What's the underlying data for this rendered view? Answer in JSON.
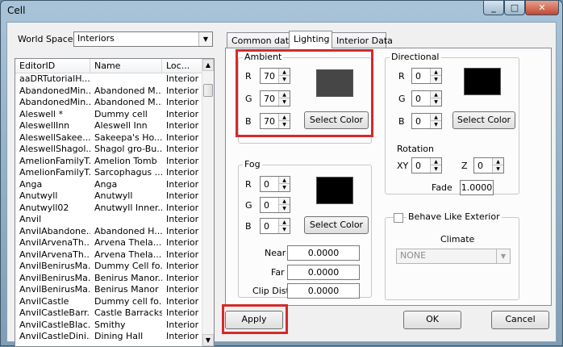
{
  "window": {
    "title": "Cell",
    "minimize": "_",
    "maximize": "□",
    "close": "✕"
  },
  "worldspace": {
    "label": "World Space",
    "value": "Interiors"
  },
  "cell_list": {
    "columns": [
      "EditorID",
      "Name",
      "Loc..."
    ],
    "rows": [
      [
        "aaDRTutorialH...",
        "",
        "Interior"
      ],
      [
        "AbandonedMin...",
        "Abandoned M...",
        "Interior"
      ],
      [
        "AbandonedMin...",
        "Abandoned M...",
        "Interior"
      ],
      [
        "Aleswell *",
        "Dummy cell",
        "Interior"
      ],
      [
        "AleswellInn",
        "Aleswell Inn",
        "Interior"
      ],
      [
        "AleswellSakee...",
        "Sakeepa's Ho...",
        "Interior"
      ],
      [
        "AleswellShagol...",
        "Shagol gro-Bu...",
        "Interior"
      ],
      [
        "AmelionFamilyT...",
        "Amelion Tomb",
        "Interior"
      ],
      [
        "AmelionFamilyT...",
        "Sarcophagus ...",
        "Interior"
      ],
      [
        "Anga",
        "Anga",
        "Interior"
      ],
      [
        "Anutwyll",
        "Anutwyll",
        "Interior"
      ],
      [
        "Anutwyll02",
        "Anutwyll Inner...",
        "Interior"
      ],
      [
        "Anvil",
        "",
        "Interior"
      ],
      [
        "AnvilAbandone...",
        "Abandoned H...",
        "Interior"
      ],
      [
        "AnvilArvenaTh...",
        "Arvena Thela...",
        "Interior"
      ],
      [
        "AnvilArvenaTh...",
        "Arvena Thela...",
        "Interior"
      ],
      [
        "AnvilBenirusMa...",
        "Dummy Cell fo...",
        "Interior"
      ],
      [
        "AnvilBenirusMa...",
        "Benirus Manor...",
        "Interior"
      ],
      [
        "AnvilBenirusMa...",
        "Benirus Manor",
        "Interior"
      ],
      [
        "AnvilCastle",
        "Dummy cell fo...",
        "Interior"
      ],
      [
        "AnvilCastleBarr...",
        "Castle Barracks",
        "Interior"
      ],
      [
        "AnvilCastleBlac...",
        "Smithy",
        "Interior"
      ],
      [
        "AnvilCastleDini...",
        "Dining Hall",
        "Interior"
      ]
    ]
  },
  "tabs": [
    "Common data",
    "Lighting",
    "Interior Data"
  ],
  "ambient": {
    "title": "Ambient",
    "r_label": "R",
    "g_label": "G",
    "b_label": "B",
    "r": "70",
    "g": "70",
    "b": "70",
    "swatch_color": "#464646",
    "button": "Select Color"
  },
  "directional": {
    "title": "Directional",
    "r_label": "R",
    "g_label": "G",
    "b_label": "B",
    "r": "0",
    "g": "0",
    "b": "0",
    "swatch_color": "#000000",
    "button": "Select Color",
    "rotation_label": "Rotation",
    "xy_label": "XY",
    "z_label": "Z",
    "xy": "0",
    "z": "0",
    "fade_label": "Fade",
    "fade": "1.0000"
  },
  "fog": {
    "title": "Fog",
    "r_label": "R",
    "g_label": "G",
    "b_label": "B",
    "r": "0",
    "g": "0",
    "b": "0",
    "swatch_color": "#000000",
    "button": "Select Color",
    "near_label": "Near",
    "near": "0.0000",
    "far_label": "Far",
    "far": "0.0000",
    "clip_label": "Clip Dist",
    "clip": "0.0000"
  },
  "exterior": {
    "checkbox_label": "Behave Like Exterior",
    "climate_label": "Climate",
    "climate_value": "NONE"
  },
  "buttons": {
    "apply": "Apply",
    "ok": "OK",
    "cancel": "Cancel"
  },
  "colors": {
    "highlight": "#d42a2a"
  }
}
